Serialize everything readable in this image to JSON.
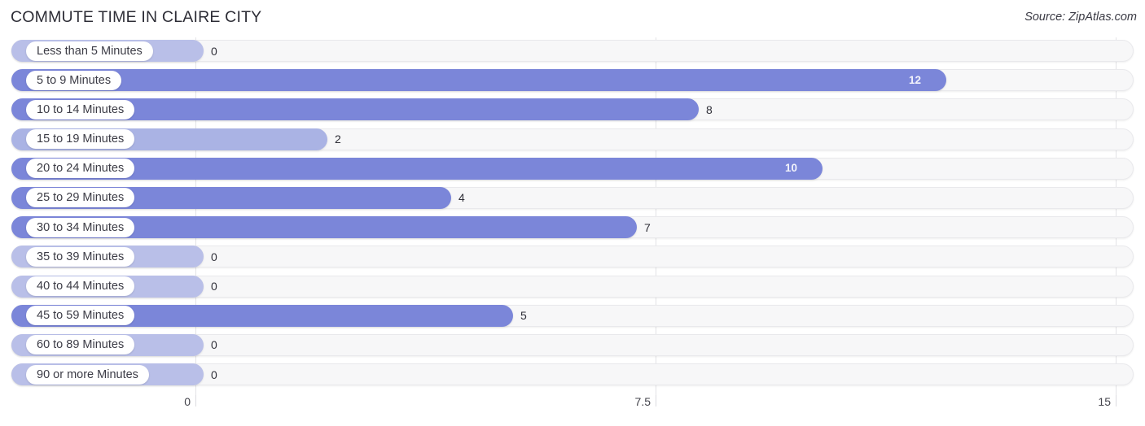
{
  "header": {
    "title": "COMMUTE TIME IN CLAIRE CITY",
    "source": "Source: ZipAtlas.com"
  },
  "colors": {
    "bar": "#7b86d9",
    "bar_zero": "#b9bfe8",
    "track": "#f7f7f8",
    "gridline": "#e3e3e6",
    "title_text": "#2d2d36",
    "value_text": "#2f2f38",
    "value_text_inside": "#f2f3fb"
  },
  "chart_data": {
    "type": "bar",
    "orientation": "horizontal",
    "title": "COMMUTE TIME IN CLAIRE CITY",
    "xlabel": "",
    "ylabel": "",
    "xlim": [
      0,
      15
    ],
    "grid": true,
    "legend": null,
    "xticks": [
      "0",
      "7.5",
      "15"
    ],
    "xtick_values": [
      0,
      7.5,
      15
    ],
    "categories": [
      "Less than 5 Minutes",
      "5 to 9 Minutes",
      "10 to 14 Minutes",
      "15 to 19 Minutes",
      "20 to 24 Minutes",
      "25 to 29 Minutes",
      "30 to 34 Minutes",
      "35 to 39 Minutes",
      "40 to 44 Minutes",
      "45 to 59 Minutes",
      "60 to 89 Minutes",
      "90 or more Minutes"
    ],
    "values": [
      0,
      12,
      8,
      2,
      10,
      4,
      7,
      0,
      0,
      5,
      0,
      0
    ],
    "value_labels": [
      "0",
      "12",
      "8",
      "2",
      "10",
      "4",
      "7",
      "0",
      "0",
      "5",
      "0",
      "0"
    ]
  }
}
